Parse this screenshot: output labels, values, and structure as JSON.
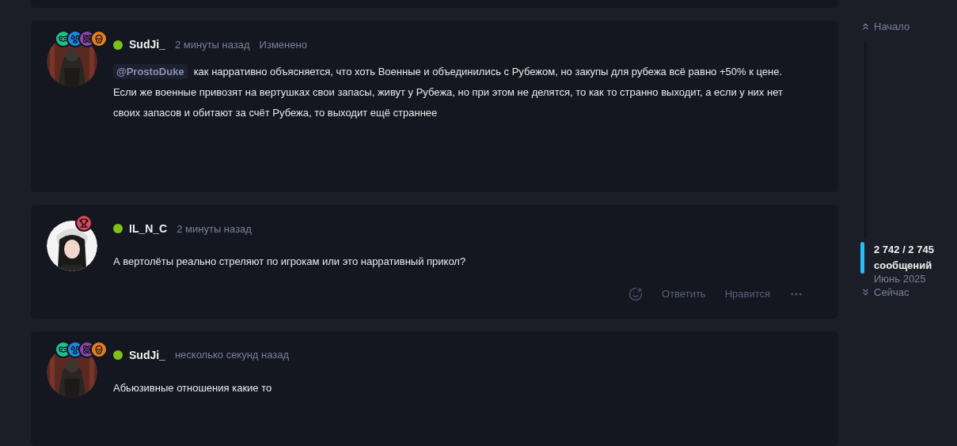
{
  "posts": [
    {
      "author": "SudJi_",
      "online": true,
      "time": "2 минуты назад",
      "edited": "Изменено",
      "badges": [
        {
          "kind": "mask",
          "color": "#1fbf8f"
        },
        {
          "kind": "radiation",
          "color": "#1e88e5"
        },
        {
          "kind": "atom",
          "color": "#8e44ad"
        },
        {
          "kind": "skull",
          "color": "#e67e22"
        }
      ],
      "mention": "@ProstoDuke",
      "text": "как нарративно объясняется, что хоть Военные и объединились с Рубежом, но закупы для рубежа всё равно +50% к цене. Если же военные привозят на вертушках свои запасы, живут у Рубежа, но при этом не делятся, то как то странно выходит, а если у них нет своих запасов и обитают за счёт Рубежа, то выходит ещё страннее"
    },
    {
      "author": "IL_N_C",
      "online": true,
      "time": "2 минуты назад",
      "badges": [
        {
          "kind": "trophy",
          "color": "#e0465e"
        }
      ],
      "text": "А вертолёты реально стреляют по игрокам или это нарративный прикол?",
      "actions": [
        "Ответить",
        "Нравится"
      ]
    },
    {
      "author": "SudJi_",
      "online": true,
      "time": "несколько секунд назад",
      "badges": [
        {
          "kind": "mask",
          "color": "#1fbf8f"
        },
        {
          "kind": "radiation",
          "color": "#1e88e5"
        },
        {
          "kind": "atom",
          "color": "#8e44ad"
        },
        {
          "kind": "skull",
          "color": "#e67e22"
        }
      ],
      "text": "Абьюзивные отношения какие то"
    }
  ],
  "timeline": {
    "start": "Начало",
    "count": "2 742 / 2 745",
    "unit": "сообщений",
    "date": "Июнь 2025",
    "end": "Сейчас"
  }
}
